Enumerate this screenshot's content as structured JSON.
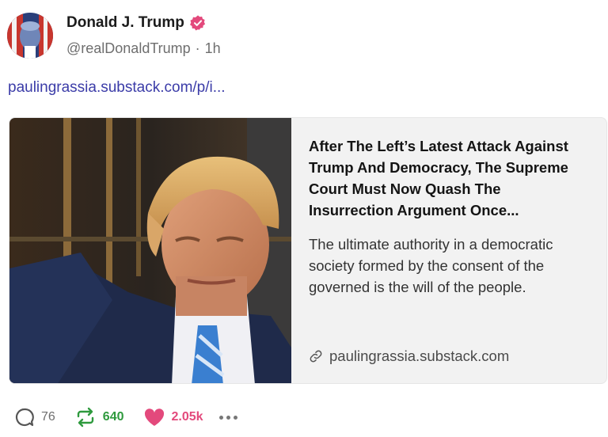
{
  "author": {
    "display_name": "Donald J. Trump",
    "handle": "@realDonaldTrump",
    "separator": "·",
    "time": "1h",
    "verified_color": "#e3497c"
  },
  "post": {
    "link_text": "paulingrassia.substack.com/p/i..."
  },
  "card": {
    "title": "After The Left’s Latest Attack Against Trump And Democracy, The Supreme Court Must Now Quash The Insurrection Argument Once...",
    "description": "The ultimate authority in a democratic society formed by the consent of the governed is the will of the people.",
    "domain": "paulingrassia.substack.com",
    "domain_icon": "link-icon"
  },
  "actions": {
    "replies": "76",
    "reblogs": "640",
    "likes": "2.05k",
    "reply_icon": "speech-bubble-icon",
    "reblog_icon": "repost-icon",
    "like_icon": "heart-icon",
    "more_icon": "ellipsis-icon"
  },
  "colors": {
    "link": "#3b3ca8",
    "reblog": "#2f9a3e",
    "like": "#e3497c"
  }
}
